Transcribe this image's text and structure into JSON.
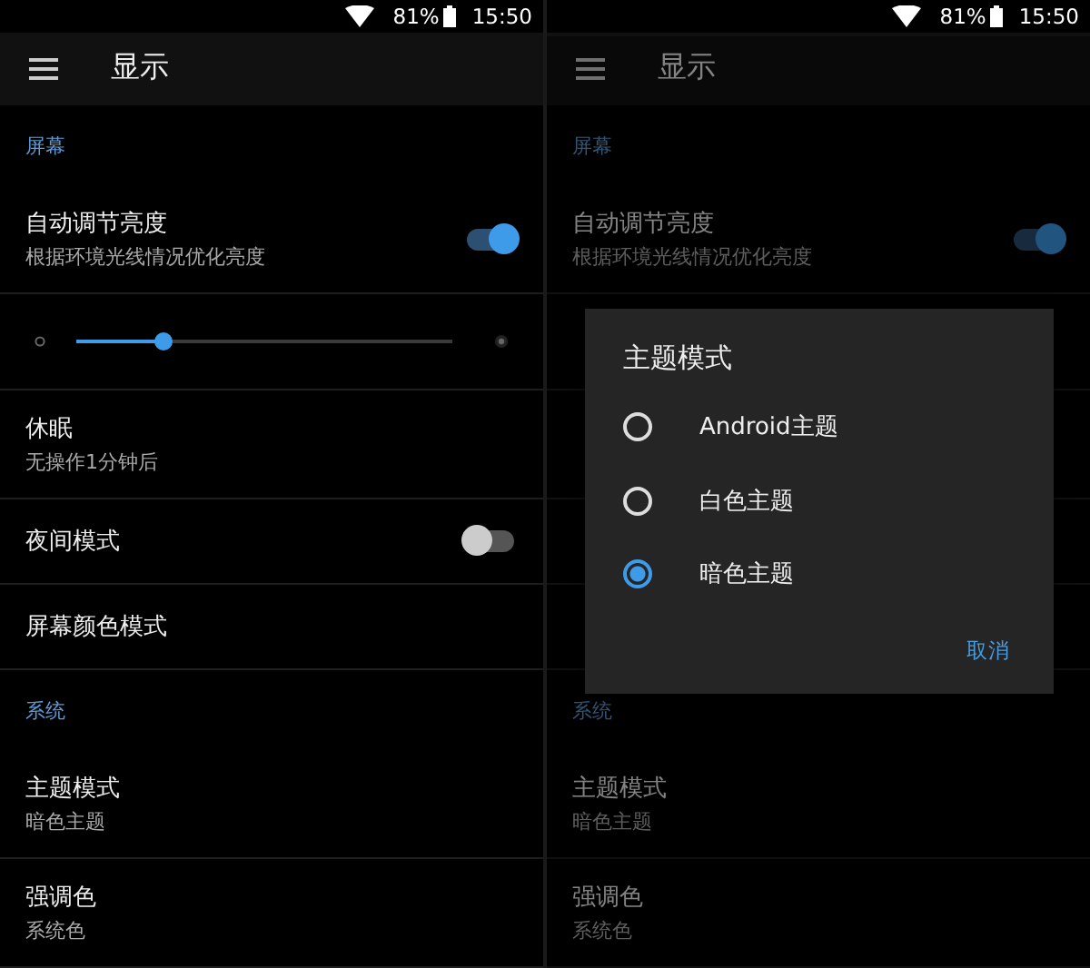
{
  "screens": [
    {
      "status_bar": {
        "battery": "81%",
        "time": "15:50"
      },
      "app_bar": {
        "title": "显示"
      },
      "items": [
        {
          "kind": "header",
          "title": "屏幕"
        },
        {
          "kind": "switch",
          "title": "自动调节亮度",
          "subtitle": "根据环境光线情况优化亮度",
          "on": true
        },
        {
          "kind": "slider",
          "level": 0.23
        },
        {
          "kind": "text",
          "title": "休眠",
          "subtitle": "无操作1分钟后"
        },
        {
          "kind": "switch",
          "title": "夜间模式",
          "on": false
        },
        {
          "kind": "text",
          "title": "屏幕颜色模式"
        },
        {
          "kind": "header",
          "title": "系统"
        },
        {
          "kind": "text",
          "title": "主题模式",
          "subtitle": "暗色主题"
        },
        {
          "kind": "text",
          "title": "强调色",
          "subtitle": "系统色"
        }
      ]
    },
    {
      "status_bar": {
        "battery": "81%",
        "time": "15:50"
      },
      "app_bar": {
        "title": "显示"
      },
      "items": [
        {
          "kind": "header",
          "title": "屏幕"
        },
        {
          "kind": "switch",
          "title": "自动调节亮度",
          "subtitle": "根据环境光线情况优化亮度",
          "on": true
        },
        {
          "kind": "coveredslider"
        },
        {
          "kind": "coveredpair"
        },
        {
          "kind": "coveredsingle"
        },
        {
          "kind": "coveredsingle"
        },
        {
          "kind": "header",
          "title": "系统"
        },
        {
          "kind": "text",
          "title": "主题模式",
          "subtitle": "暗色主题"
        },
        {
          "kind": "text",
          "title": "强调色",
          "subtitle": "系统色"
        }
      ],
      "dialog": {
        "title": "主题模式",
        "options": [
          {
            "label": "Android主题",
            "selected": false
          },
          {
            "label": "白色主题",
            "selected": false
          },
          {
            "label": "暗色主题",
            "selected": true
          }
        ],
        "button": "取消"
      }
    }
  ]
}
